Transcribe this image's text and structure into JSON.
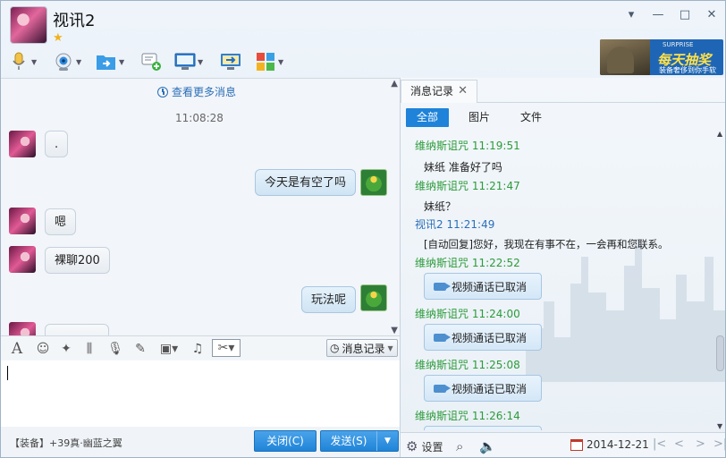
{
  "contact": {
    "name": "视讯2"
  },
  "window_controls": {
    "menu": "▾",
    "minimize": "—",
    "maximize": "□",
    "close": "✕"
  },
  "ad": {
    "logo": "SURPRISE",
    "main": "每天抽奖",
    "sub": "装备奢侈到你手软"
  },
  "chat": {
    "more_link": "查看更多消息",
    "timestamp": "11:08:28",
    "messages": [
      {
        "from": "them",
        "text": "."
      },
      {
        "from": "me",
        "text": "今天是有空了吗"
      },
      {
        "from": "them",
        "text": "嗯"
      },
      {
        "from": "them",
        "text": "裸聊200"
      },
      {
        "from": "me",
        "text": "玩法呢"
      }
    ]
  },
  "input_toolbar": {
    "history_label": "消息记录"
  },
  "bottom": {
    "signature": "【装备】+39真·幽蓝之翼",
    "close_label": "关闭(C)",
    "send_label": "发送(S)"
  },
  "history_panel": {
    "tab_label": "消息记录",
    "filters": [
      "全部",
      "图片",
      "文件"
    ],
    "records": [
      {
        "sender": "维纳斯诅咒",
        "time": "11:19:51",
        "text": "妹纸 准备好了吗",
        "type": "text",
        "color": "green"
      },
      {
        "sender": "维纳斯诅咒",
        "time": "11:21:47",
        "text": "妹纸？",
        "type": "text",
        "color": "green"
      },
      {
        "sender": "视讯2",
        "time": "11:21:49",
        "text": "[自动回复]您好，我现在有事不在，一会再和您联系。",
        "type": "text",
        "color": "blue"
      },
      {
        "sender": "维纳斯诅咒",
        "time": "11:22:52",
        "text": "视频通话已取消",
        "type": "call",
        "color": "green"
      },
      {
        "sender": "维纳斯诅咒",
        "time": "11:24:00",
        "text": "视频通话已取消",
        "type": "call",
        "color": "green"
      },
      {
        "sender": "维纳斯诅咒",
        "time": "11:25:08",
        "text": "视频通话已取消",
        "type": "call",
        "color": "green"
      },
      {
        "sender": "维纳斯诅咒",
        "time": "11:26:14",
        "text": "",
        "type": "call",
        "color": "green"
      }
    ],
    "footer": {
      "settings_label": "设置",
      "date": "2014-12-21"
    }
  },
  "colors": {
    "accent": "#1e83d9",
    "green_sender": "#2c9b3a",
    "blue_sender": "#2a6fb8"
  }
}
